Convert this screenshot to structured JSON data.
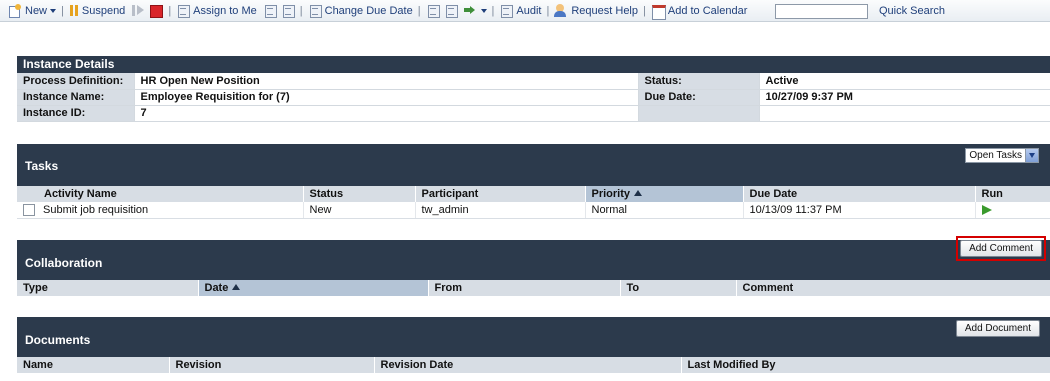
{
  "toolbar": {
    "new": "New",
    "suspend": "Suspend",
    "assign_to_me": "Assign to Me",
    "change_due_date": "Change Due Date",
    "audit": "Audit",
    "request_help": "Request Help",
    "add_to_calendar": "Add to Calendar",
    "quick_search_value": "",
    "quick_search": "Quick Search"
  },
  "instance": {
    "title": "Instance Details",
    "rows": [
      {
        "label": "Process Definition:",
        "value": "HR Open New Position",
        "label2": "Status:",
        "value2": "Active"
      },
      {
        "label": "Instance Name:",
        "value": "Employee Requisition for (7)",
        "label2": "Due Date:",
        "value2": "10/27/09 9:37 PM"
      },
      {
        "label": "Instance ID:",
        "value": "7",
        "label2": "",
        "value2": ""
      }
    ]
  },
  "tasks": {
    "title": "Tasks",
    "filter": "Open Tasks",
    "columns": [
      "Activity Name",
      "Status",
      "Participant",
      "Priority",
      "Due Date",
      "Run"
    ],
    "rows": [
      {
        "activity": "Submit job requisition",
        "status": "New",
        "participant": "tw_admin",
        "priority": "Normal",
        "due": "10/13/09 11:37 PM"
      }
    ]
  },
  "collaboration": {
    "title": "Collaboration",
    "add_comment": "Add Comment",
    "columns": [
      "Type",
      "Date",
      "From",
      "To",
      "Comment"
    ]
  },
  "documents": {
    "title": "Documents",
    "add_document": "Add Document",
    "columns": [
      "Name",
      "Revision",
      "Revision Date",
      "Last Modified By"
    ]
  },
  "colors": {
    "header_dark": "#2c3a4c",
    "header_light": "#d7dde4",
    "sorted_column": "#b4c4d6",
    "highlight_red": "#d40000"
  }
}
